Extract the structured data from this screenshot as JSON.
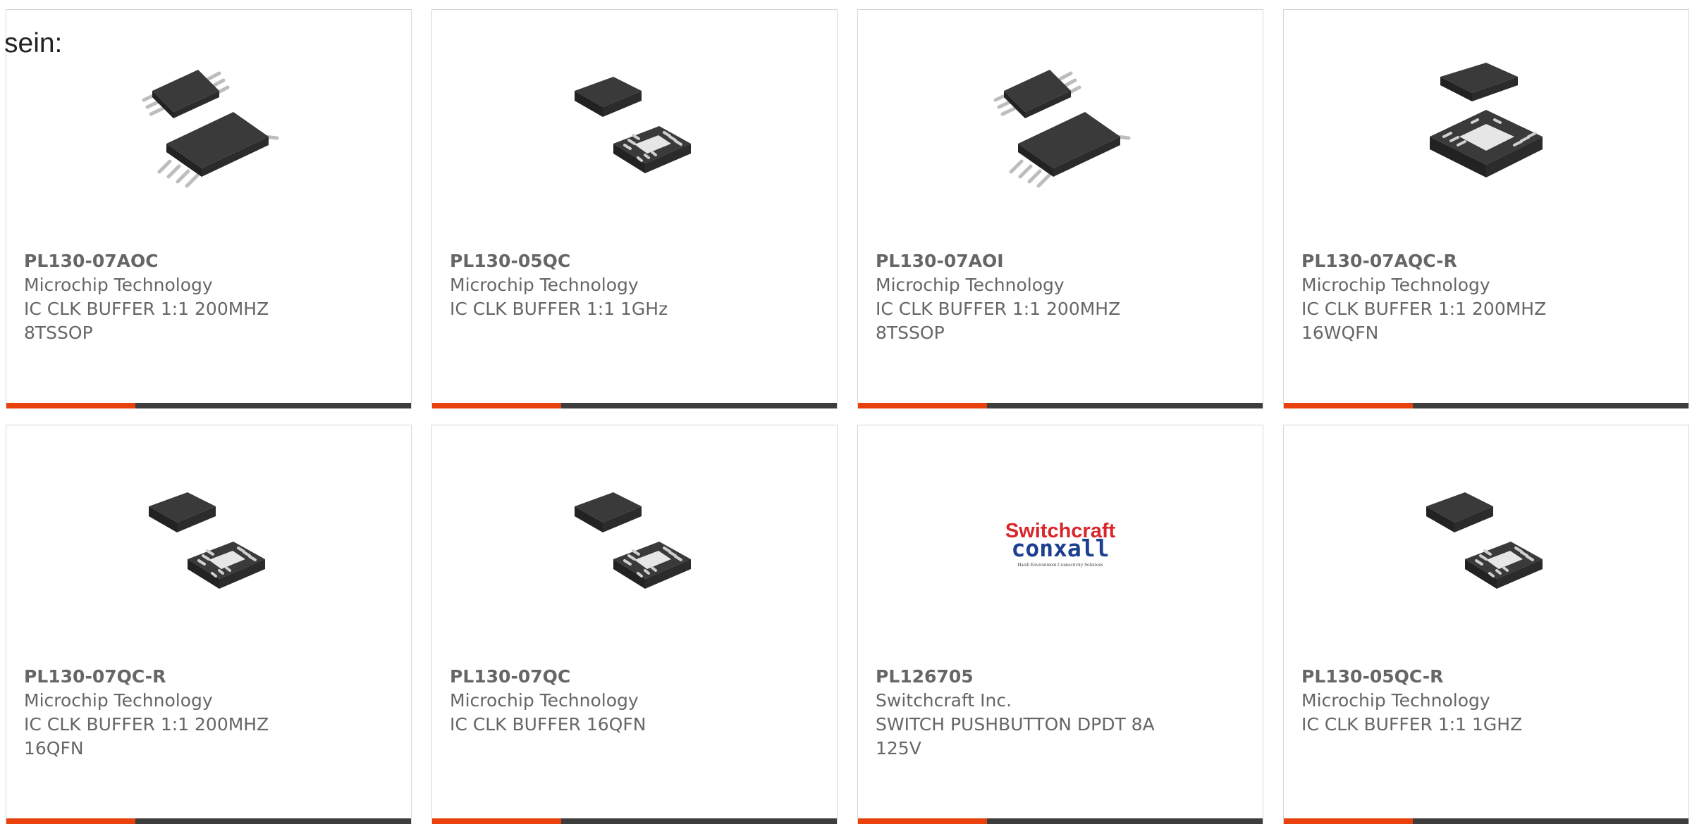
{
  "page": {
    "intro": "sein:"
  },
  "colors": {
    "accent": "#e8410e",
    "bar": "#3d3d3d",
    "text": "#666666",
    "border": "#d6d6d6"
  },
  "products": [
    {
      "part": "PL130-07AOC",
      "maker": "Microchip Technology",
      "desc1": "IC CLK BUFFER 1:1 200MHZ",
      "desc2": "8TSSOP",
      "image": "tssop-package-image"
    },
    {
      "part": "PL130-05QC",
      "maker": "Microchip Technology",
      "desc1": "IC CLK BUFFER 1:1 1GHz",
      "desc2": "",
      "image": "qfn-package-image"
    },
    {
      "part": "PL130-07AOI",
      "maker": "Microchip Technology",
      "desc1": "IC CLK BUFFER 1:1 200MHZ",
      "desc2": "8TSSOP",
      "image": "tssop-package-image"
    },
    {
      "part": "PL130-07AQC-R",
      "maker": "Microchip Technology",
      "desc1": "IC CLK BUFFER 1:1 200MHZ",
      "desc2": "16WQFN",
      "image": "wqfn-package-image"
    },
    {
      "part": "PL130-07QC-R",
      "maker": "Microchip Technology",
      "desc1": "IC CLK BUFFER 1:1 200MHZ",
      "desc2": "16QFN",
      "image": "qfn-package-image"
    },
    {
      "part": "PL130-07QC",
      "maker": "Microchip Technology",
      "desc1": "IC CLK BUFFER 16QFN",
      "desc2": "",
      "image": "qfn-package-image"
    },
    {
      "part": "PL126705",
      "maker": "Switchcraft Inc.",
      "desc1": "SWITCH PUSHBUTTON DPDT 8A",
      "desc2": "125V",
      "image": "switchcraft-conxall-logo",
      "logo": {
        "line1": "Switchcraft",
        "line2": "conxall",
        "tagline": "Harsh Environment Connectivity Solutions"
      }
    },
    {
      "part": "PL130-05QC-R",
      "maker": "Microchip Technology",
      "desc1": "IC CLK BUFFER 1:1 1GHZ",
      "desc2": "",
      "image": "qfn-package-image"
    }
  ]
}
